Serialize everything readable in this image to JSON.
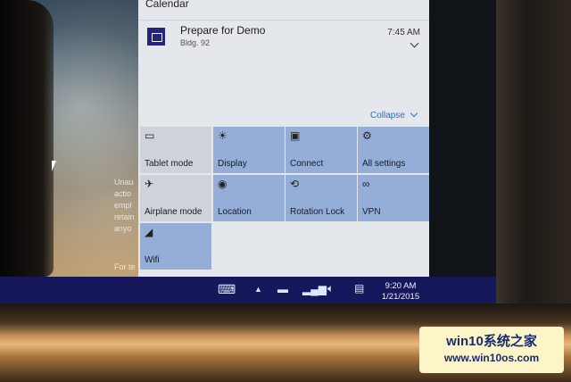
{
  "action_center": {
    "header": "Calendar",
    "notification": {
      "title": "Prepare for Demo",
      "location": "Bldg. 92",
      "time": "7:45 AM"
    },
    "collapse_label": "Collapse",
    "quick_actions": [
      {
        "label": "Tablet mode",
        "icon": "tablet-icon",
        "state": "off"
      },
      {
        "label": "Display",
        "icon": "brightness-icon",
        "state": "on"
      },
      {
        "label": "Connect",
        "icon": "connect-icon",
        "state": "on"
      },
      {
        "label": "All settings",
        "icon": "gear-icon",
        "state": "on"
      },
      {
        "label": "Airplane mode",
        "icon": "airplane-icon",
        "state": "off"
      },
      {
        "label": "Location",
        "icon": "location-icon",
        "state": "on"
      },
      {
        "label": "Rotation Lock",
        "icon": "rotation-lock-icon",
        "state": "on"
      },
      {
        "label": "VPN",
        "icon": "vpn-icon",
        "state": "on"
      },
      {
        "label": "Wifi",
        "icon": "wifi-icon",
        "state": "on"
      }
    ]
  },
  "lock_text": [
    "Unau",
    "actio",
    "empl",
    "retain",
    "anyo"
  ],
  "lock_footer": "For te",
  "taskbar": {
    "tray_icons": [
      "keyboard-icon",
      "chevron-up-icon",
      "battery-icon",
      "signal-icon",
      "volume-icon",
      "action-center-icon"
    ],
    "time": "9:20 AM",
    "date": "1/21/2015"
  },
  "watermark": {
    "line1": "win10系统之家",
    "line2": "www.win10os.com"
  },
  "colors": {
    "taskbar": "#17175c",
    "tile_on": "#94aed8",
    "tile_off": "#cfd3d9",
    "accent": "#2d6fc4"
  }
}
